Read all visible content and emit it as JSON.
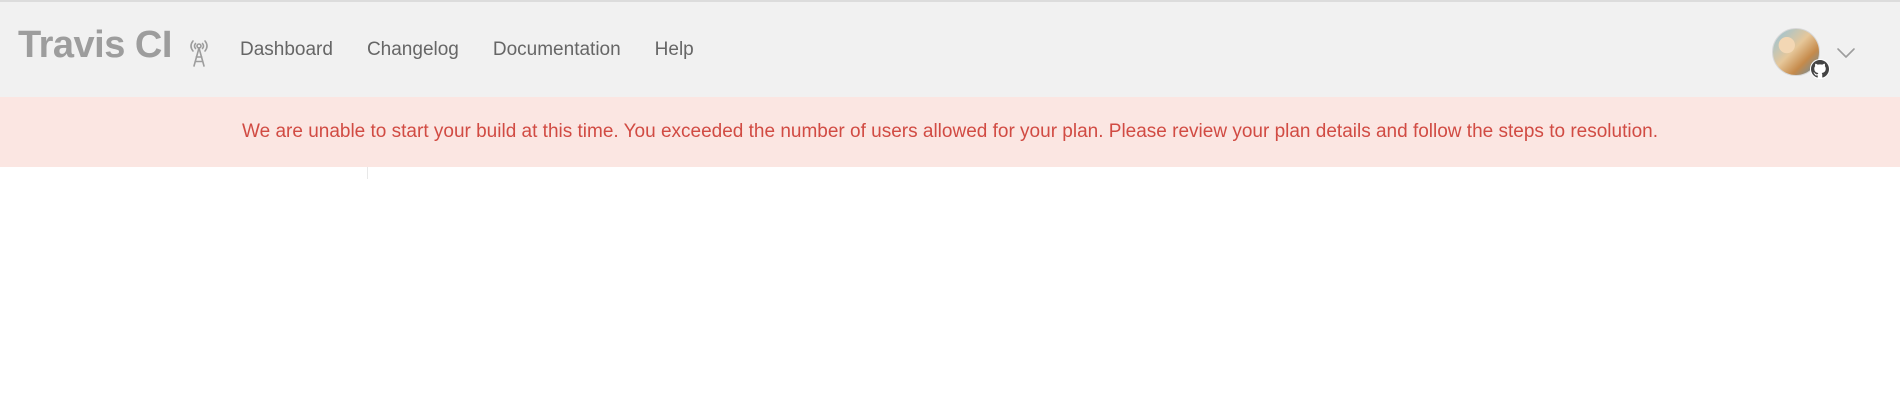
{
  "header": {
    "logo_text": "Travis CI",
    "broadcast_icon": "antenna-icon",
    "nav_items": [
      {
        "label": "Dashboard"
      },
      {
        "label": "Changelog"
      },
      {
        "label": "Documentation"
      },
      {
        "label": "Help"
      }
    ],
    "account": {
      "avatar_icon": "user-avatar",
      "provider_icon": "github-icon",
      "menu_icon": "chevron-down-icon"
    }
  },
  "alert": {
    "message": "We are unable to start your build at this time. You exceeded the number of users allowed for your plan. Please review your plan details and follow the steps to resolution.",
    "color": "#d14b43",
    "background": "#fbe6e2"
  },
  "colors": {
    "header_bg": "#f1f1f1",
    "logo": "#9d9d9d",
    "nav_text": "#666666"
  }
}
